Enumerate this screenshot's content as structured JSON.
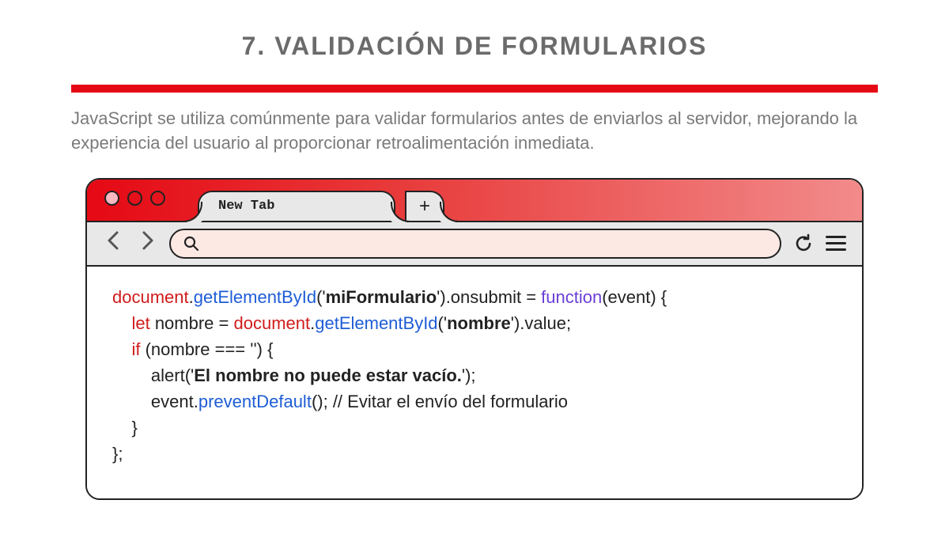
{
  "title": "7. VALIDACIÓN DE FORMULARIOS",
  "description": "JavaScript se utiliza comúnmente para validar formularios antes de enviarlos al servidor, mejorando la experiencia del usuario al proporcionar retroalimentación inmediata.",
  "browser": {
    "tab_label": "New Tab",
    "plus": "+"
  },
  "code": {
    "l1": {
      "a": "document",
      "b": ".",
      "c": "getElementById",
      "d": "('",
      "e": "miFormulario",
      "f": "').onsubmit = ",
      "g": "function",
      "h": "(event) {"
    },
    "l2": {
      "a": "    ",
      "b": "let",
      "c": " nombre = ",
      "d": "document",
      "e": ".",
      "f": "getElementById",
      "g": "('",
      "h": "nombre",
      "i": "').value;"
    },
    "l3": {
      "a": "    ",
      "b": "if",
      "c": " (nombre === '') {"
    },
    "l4": {
      "a": "        alert('",
      "b": "El nombre no puede estar vacío.",
      "c": "');"
    },
    "l5": {
      "a": "        event.",
      "b": "preventDefault",
      "c": "(); // Evitar el envío del formulario"
    },
    "l6": "    }",
    "l7": "};"
  }
}
